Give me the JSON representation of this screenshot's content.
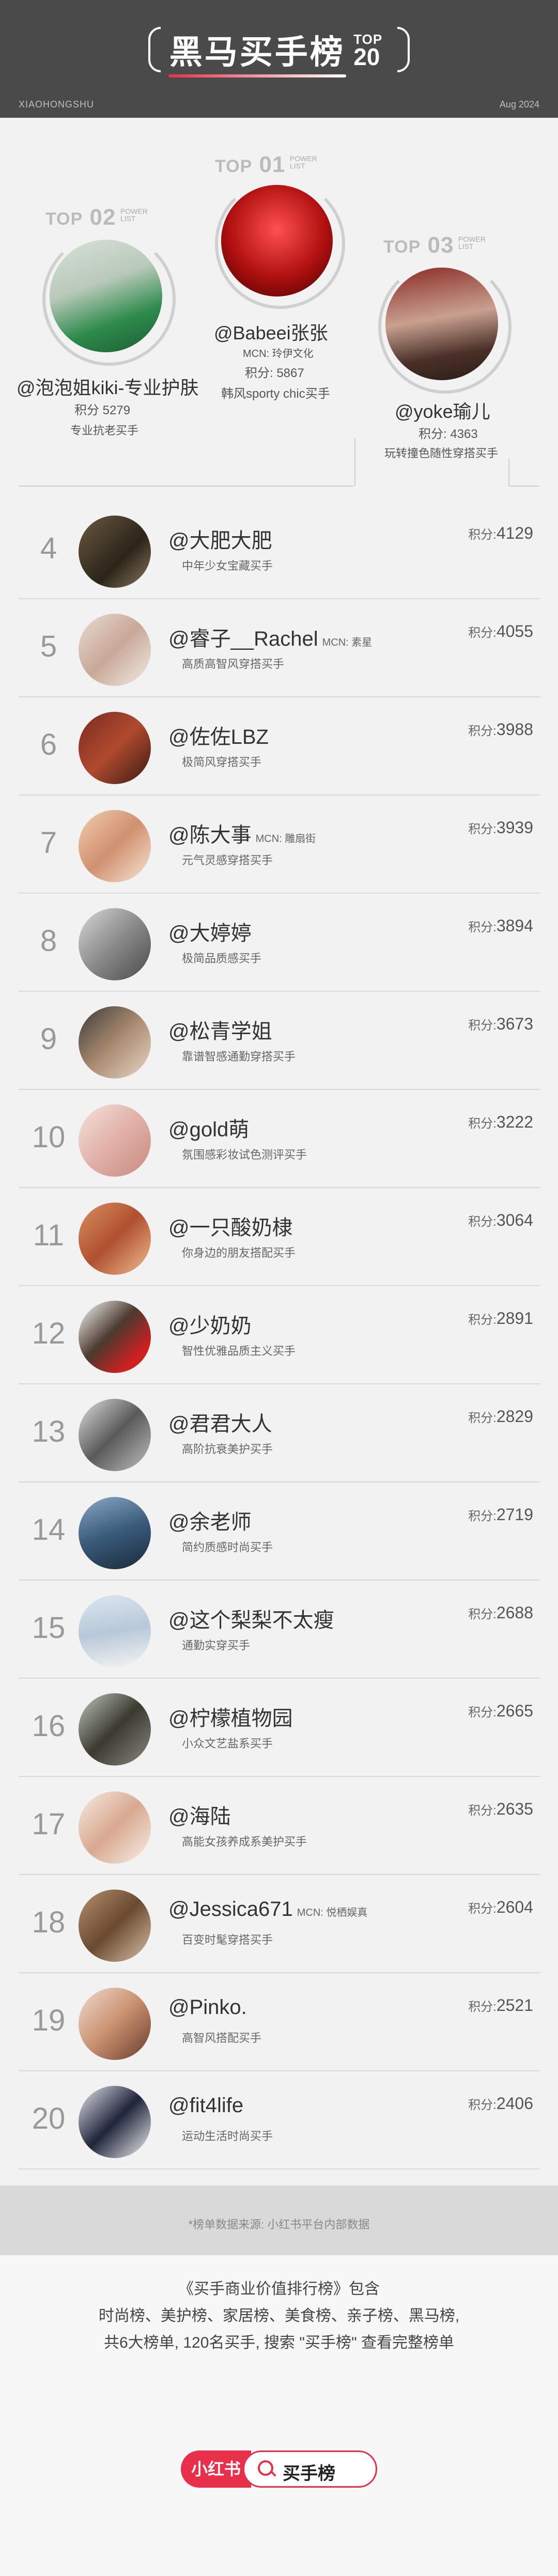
{
  "header": {
    "title": "黑马买手榜",
    "badge_top": "TOP",
    "badge_num": "20",
    "left_caption": "XIAOHONGSHU",
    "right_caption": "Aug 2024"
  },
  "colors": {
    "header_bg": "#4a4a4a",
    "accent": "#e8304a",
    "page_bg": "#f2f2f2"
  },
  "podium": {
    "top1": {
      "label_top": "TOP",
      "label_num": "01",
      "label_small_1": "POWER",
      "label_small_2": "LIST",
      "name": "@Babeei张张",
      "mcn": "MCN: 玲伊文化",
      "score": "积分: 5867",
      "desc": "韩风sporty chic买手"
    },
    "top2": {
      "label_top": "TOP",
      "label_num": "02",
      "label_small_1": "POWER",
      "label_small_2": "LIST",
      "name": "@泡泡姐kiki-专业护肤",
      "score": "积分 5279",
      "desc": "专业抗老买手"
    },
    "top3": {
      "label_top": "TOP",
      "label_num": "03",
      "label_small_1": "POWER",
      "label_small_2": "LIST",
      "name": "@yoke瑜儿",
      "score": "积分: 4363",
      "desc": "玩转撞色随性穿搭买手"
    }
  },
  "ranks": [
    {
      "rank": "4",
      "name": "@大肥大肥",
      "mcn": "",
      "desc": "中年少女宝藏买手",
      "score_label": "积分:",
      "score": "4129"
    },
    {
      "rank": "5",
      "name": "@睿子__Rachel",
      "mcn": "MCN: 素星",
      "desc": "高质高智风穿搭买手",
      "score_label": "积分:",
      "score": "4055"
    },
    {
      "rank": "6",
      "name": "@佐佐LBZ",
      "mcn": "",
      "desc": "极简风穿搭买手",
      "score_label": "积分:",
      "score": "3988"
    },
    {
      "rank": "7",
      "name": "@陈大事",
      "mcn": "MCN: 雕扇街",
      "desc": "元气灵感穿搭买手",
      "score_label": "积分:",
      "score": "3939"
    },
    {
      "rank": "8",
      "name": "@大婷婷",
      "mcn": "",
      "desc": "极简品质感买手",
      "score_label": "积分:",
      "score": "3894"
    },
    {
      "rank": "9",
      "name": "@松青学姐",
      "mcn": "",
      "desc": "靠谱智感通勤穿搭买手",
      "score_label": "积分:",
      "score": "3673"
    },
    {
      "rank": "10",
      "name": "@gold萌",
      "mcn": "",
      "desc": "氛围感彩妆试色测评买手",
      "score_label": "积分:",
      "score": "3222"
    },
    {
      "rank": "11",
      "name": "@一只酸奶棣",
      "mcn": "",
      "desc": "你身边的朋友搭配买手",
      "score_label": "积分:",
      "score": "3064"
    },
    {
      "rank": "12",
      "name": "@少奶奶",
      "mcn": "",
      "desc": "智性优雅品质主义买手",
      "score_label": "积分:",
      "score": "2891"
    },
    {
      "rank": "13",
      "name": "@君君大人",
      "mcn": "",
      "desc": "高阶抗衰美护买手",
      "score_label": "积分:",
      "score": "2829"
    },
    {
      "rank": "14",
      "name": "@余老师",
      "mcn": "",
      "desc": "简约质感时尚买手",
      "score_label": "积分:",
      "score": "2719"
    },
    {
      "rank": "15",
      "name": "@这个梨梨不太瘦",
      "mcn": "",
      "desc": "通勤实穿买手",
      "score_label": "积分:",
      "score": "2688"
    },
    {
      "rank": "16",
      "name": "@柠檬植物园",
      "mcn": "",
      "desc": "小众文艺盐系买手",
      "score_label": "积分:",
      "score": "2665"
    },
    {
      "rank": "17",
      "name": "@海陆",
      "mcn": "",
      "desc": "高能女孩养成系美护买手",
      "score_label": "积分:",
      "score": "2635"
    },
    {
      "rank": "18",
      "name": "@Jessica671",
      "mcn": "MCN: 悦栖娱真",
      "desc": "百变时髦穿搭买手",
      "score_label": "积分:",
      "score": "2604"
    },
    {
      "rank": "19",
      "name": "@Pinko.",
      "mcn": "",
      "desc": "高智风搭配买手",
      "score_label": "积分:",
      "score": "2521"
    },
    {
      "rank": "20",
      "name": "@fit4life",
      "mcn": "",
      "desc": "运动生活时尚买手",
      "score_label": "积分:",
      "score": "2406"
    }
  ],
  "source": "*榜单数据来源: 小红书平台内部数据",
  "footer": {
    "line1": "《买手商业价值排行榜》包含",
    "line2": "时尚榜、美护榜、家居榜、美食榜、亲子榜、黑马榜,",
    "line3": "共6大榜单, 120名买手, 搜索 \"买手榜\" 查看完整榜单",
    "brand": "小红书",
    "search_label": "买手榜"
  }
}
